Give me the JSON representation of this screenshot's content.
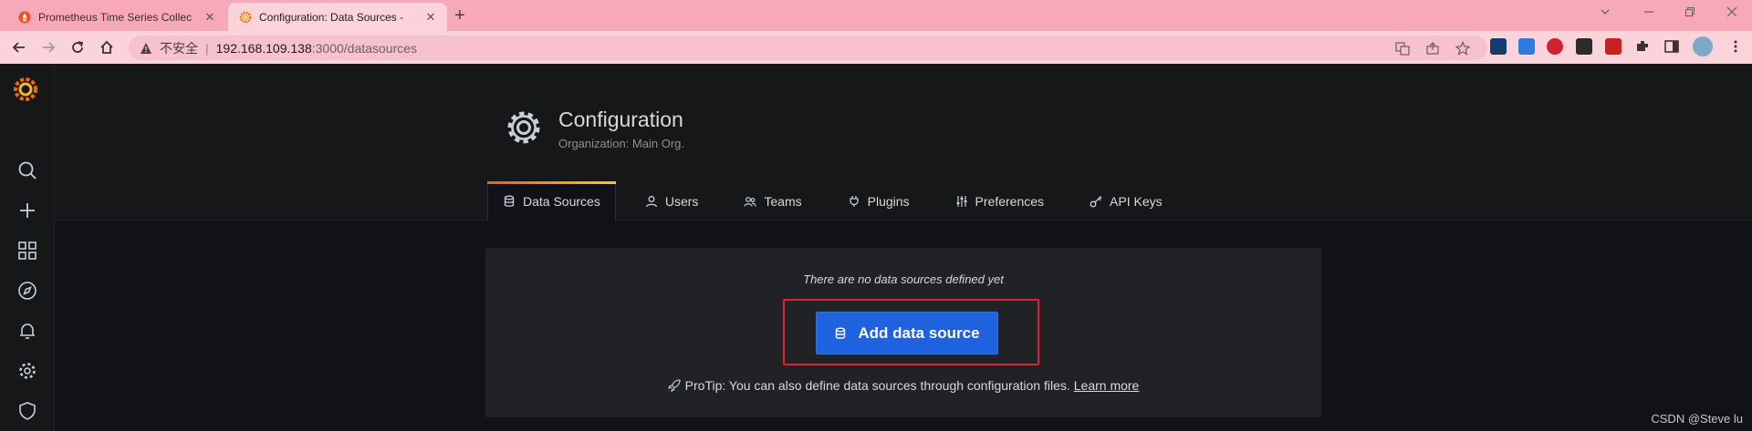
{
  "browser": {
    "tabs": [
      {
        "title": "Prometheus Time Series Collec",
        "close": "✕"
      },
      {
        "title": "Configuration: Data Sources -",
        "close": "✕"
      }
    ],
    "new_tab": "+",
    "address": {
      "insecure_label": "不安全",
      "separator": "|",
      "host": "192.168.109.138",
      "path": ":3000/datasources"
    }
  },
  "page": {
    "title": "Configuration",
    "subtitle": "Organization: Main Org.",
    "tabs": [
      {
        "label": "Data Sources",
        "icon": "database-icon",
        "active": true
      },
      {
        "label": "Users",
        "icon": "user-icon"
      },
      {
        "label": "Teams",
        "icon": "users-icon"
      },
      {
        "label": "Plugins",
        "icon": "plug-icon"
      },
      {
        "label": "Preferences",
        "icon": "sliders-icon"
      },
      {
        "label": "API Keys",
        "icon": "key-icon"
      }
    ]
  },
  "empty_state": {
    "message": "There are no data sources defined yet",
    "button_label": "Add data source",
    "protip_text": "ProTip: You can also define data sources through configuration files.",
    "protip_link": "Learn more"
  },
  "watermark": "CSDN @Steve lu",
  "colors": {
    "tabstrip": "#f8a9b9",
    "toolbar": "#fbd3db",
    "app_bg": "#111217",
    "primary_button": "#1f62e0",
    "highlight_box": "#e3202f",
    "active_tab_gradient": [
      "#f05a28",
      "#fbca0a"
    ]
  }
}
